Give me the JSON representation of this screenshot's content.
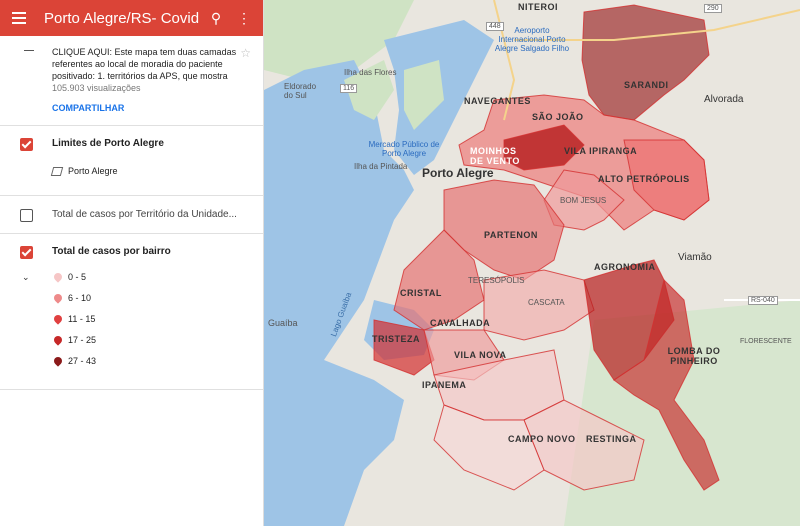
{
  "header": {
    "title": "Porto Alegre/RS- Covid-...",
    "search_icon": "search-icon",
    "more_icon": "more-vert-icon"
  },
  "description": {
    "text": "CLIQUE AQUI: Este mapa tem duas camadas referentes ao local de moradia do paciente positivado: 1. territórios da APS, que mostra",
    "views": "105.903 visualizações",
    "share": "COMPARTILHAR"
  },
  "layers": [
    {
      "name": "Limites de Porto Alegre",
      "checked": true,
      "sub": "Porto Alegre"
    },
    {
      "name": "Total de casos por Território da Unidade...",
      "checked": false
    },
    {
      "name": "Total de casos por bairro",
      "checked": true
    }
  ],
  "legend": [
    {
      "label": "0 - 5",
      "color": "#f6c6c6"
    },
    {
      "label": "6 - 10",
      "color": "#ee8a8a"
    },
    {
      "label": "11 - 15",
      "color": "#e04040"
    },
    {
      "label": "17 - 25",
      "color": "#c62828"
    },
    {
      "label": "27 - 43",
      "color": "#8b1a1a"
    }
  ],
  "map_labels": {
    "niteroi": "NITEROI",
    "airport": "Aeroporto Internacional Porto Alegre Salgado Filho",
    "sarandi": "SARANDI",
    "alvorada": "Alvorada",
    "navegantes": "NAVEGANTES",
    "sao_joao": "SÃO JOÃO",
    "ilha_flores": "Ilha das Flores",
    "eldorado": "Eldorado do Sul",
    "mercado": "Mercado Público de Porto Alegre",
    "moinhos": "MOINHOS DE VENTO",
    "vila_ipiranga": "VILA IPIRANGA",
    "ilha_pintada": "Ilha da Pintada",
    "porto_alegre": "Porto Alegre",
    "alto_petropolis": "ALTO PETRÓPOLIS",
    "bom_jesus": "BOM JESUS",
    "partenon": "PARTENON",
    "viamao": "Viamão",
    "agronomia": "AGRONOMIA",
    "cristal": "CRISTAL",
    "teresopolis": "TERESÓPOLIS",
    "cascata": "CASCATA",
    "cavalhada": "CAVALHADA",
    "tristeza": "TRISTEZA",
    "vila_nova": "VILA NOVA",
    "lomba": "LOMBA DO PINHEIRO",
    "florescente": "FLORESCENTE",
    "ipanema": "IPANEMA",
    "campo_novo": "CAMPO NOVO",
    "restinga": "RESTINGA",
    "guaiba": "Guaíba",
    "lago": "Lago Guaíba",
    "rs040": "RS-040",
    "r448": "448",
    "r290": "290",
    "r116": "116"
  }
}
